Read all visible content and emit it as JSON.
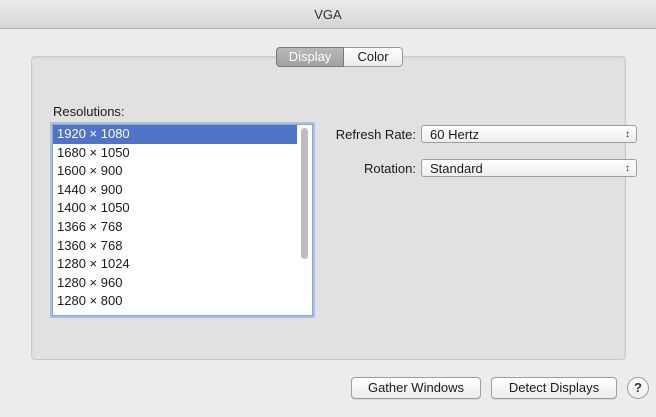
{
  "window": {
    "title": "VGA"
  },
  "tabs": [
    {
      "label": "Display",
      "active": true
    },
    {
      "label": "Color",
      "active": false
    }
  ],
  "resolutions": {
    "label": "Resolutions:",
    "items": [
      "1920 × 1080",
      "1680 × 1050",
      "1600 × 900",
      "1440 × 900",
      "1400 × 1050",
      "1366 × 768",
      "1360 × 768",
      "1280 × 1024",
      "1280 × 960",
      "1280 × 800"
    ],
    "selected_index": 0
  },
  "refresh_rate": {
    "label": "Refresh Rate:",
    "value": "60 Hertz"
  },
  "rotation": {
    "label": "Rotation:",
    "value": "Standard"
  },
  "buttons": {
    "gather_windows": "Gather Windows",
    "detect_displays": "Detect Displays",
    "help": "?"
  },
  "icons": {
    "select_arrows": "↕",
    "help": "question-icon"
  },
  "colors": {
    "selection": "#4f73c9",
    "focus_ring": "#a7c1e6"
  }
}
